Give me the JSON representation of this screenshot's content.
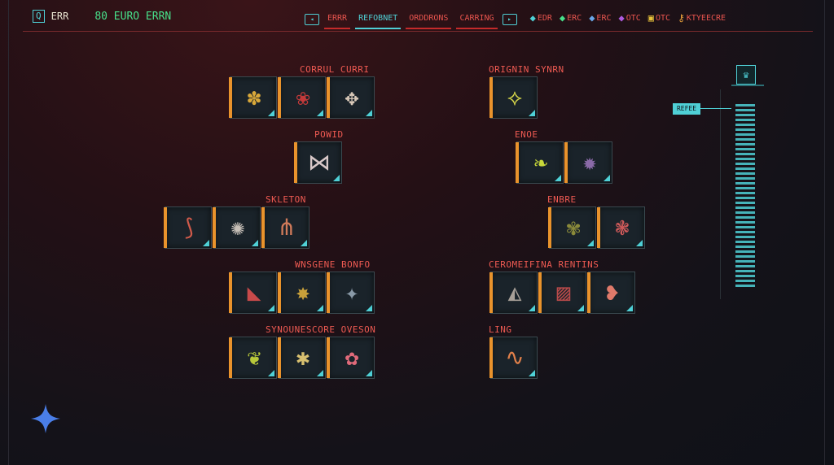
{
  "hud": {
    "back_key": "Q",
    "back_label": "ERR",
    "money_label": "80 EURO ERRN"
  },
  "tabs": [
    {
      "label": "ERRR",
      "active": false
    },
    {
      "label": "REFOBNET",
      "active": true
    },
    {
      "label": "ORDDRONS",
      "active": false
    },
    {
      "label": "CARRING",
      "active": false
    }
  ],
  "resources": [
    {
      "icon": "gem-icon",
      "value": "EDR",
      "color": "#4fd0d6"
    },
    {
      "icon": "green-ore-icon",
      "value": "ERC",
      "color": "#47e08a"
    },
    {
      "icon": "blue-ore-icon",
      "value": "ERC",
      "color": "#6aa6e8"
    },
    {
      "icon": "purple-ore-icon",
      "value": "OTC",
      "color": "#b05be0"
    },
    {
      "icon": "gold-ore-icon",
      "value": "OTC",
      "color": "#e8c23a"
    },
    {
      "icon": "key-icon",
      "value": "KTYEECRE",
      "color": "#e8a03a"
    }
  ],
  "sections": [
    {
      "title": "CORRUL CURRI",
      "items": [
        "yellow-creature",
        "red-flower",
        "claw-pile"
      ]
    },
    {
      "title": "POWID",
      "items": [
        "fish-skeleton"
      ]
    },
    {
      "title": "SKLETON",
      "items": [
        "red-limbs",
        "bone-flail",
        "bone-claws"
      ]
    },
    {
      "title": "WNSGENE BONFO",
      "items": [
        "red-wing",
        "gold-hide",
        "dark-scrap"
      ]
    },
    {
      "title": "SYNOUNESCORE OVESON",
      "items": [
        "green-frond",
        "gold-coral",
        "red-bloom"
      ]
    },
    {
      "title": "ORIGNIN SYNRN",
      "items": [
        "yellow-fish"
      ]
    },
    {
      "title": "ENOE",
      "items": [
        "green-slug",
        "purple-orb"
      ]
    },
    {
      "title": "ENBRE",
      "items": [
        "moss-clump",
        "red-cluster"
      ]
    },
    {
      "title": "CEROMEIFINA RENTINS",
      "items": [
        "gray-shell",
        "red-fabric",
        "red-meat"
      ]
    },
    {
      "title": "LING",
      "items": [
        "orange-eel"
      ]
    }
  ],
  "side_bar": {
    "top_icon": "tier-icon",
    "tag": "REFEE"
  },
  "colors": {
    "accent_red": "#e8544e",
    "accent_cyan": "#4fd0d6",
    "slot_edge": "#e9932c"
  }
}
